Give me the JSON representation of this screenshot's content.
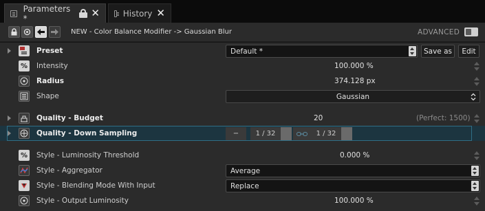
{
  "tabs": [
    {
      "label": "Parameters *",
      "active": true
    },
    {
      "label": "History",
      "active": false
    }
  ],
  "toolbar": {
    "breadcrumb": "NEW - Color Balance Modifier -> Gaussian Blur",
    "advanced_label": "ADVANCED",
    "advanced_on": true
  },
  "rows": {
    "preset": {
      "label": "Preset",
      "value": "Default *",
      "save_as": "Save as",
      "edit": "Edit"
    },
    "intensity": {
      "label": "Intensity",
      "value": "100.000 %"
    },
    "radius": {
      "label": "Radius",
      "value": "374.128 px"
    },
    "shape": {
      "label": "Shape",
      "value": "Gaussian"
    },
    "budget": {
      "label": "Quality - Budget",
      "value": "20",
      "hint": "(Perfect: 1500)"
    },
    "downsampling": {
      "label": "Quality - Down Sampling",
      "x_value": "1 / 32",
      "y_value": "1 / 32",
      "minus": "−"
    },
    "lum_threshold": {
      "label": "Style - Luminosity Threshold",
      "value": "0.000 %"
    },
    "aggregator": {
      "label": "Style - Aggregator",
      "value": "Average"
    },
    "blending": {
      "label": "Style - Blending Mode With Input",
      "value": "Replace"
    },
    "output_lum": {
      "label": "Style - Output Luminosity",
      "value": "100.000 %"
    }
  },
  "icons": {
    "intensity": "%",
    "threshold": "%"
  },
  "colors": {
    "highlight_bg": "#1c3540",
    "highlight_border": "#2f6f86"
  }
}
